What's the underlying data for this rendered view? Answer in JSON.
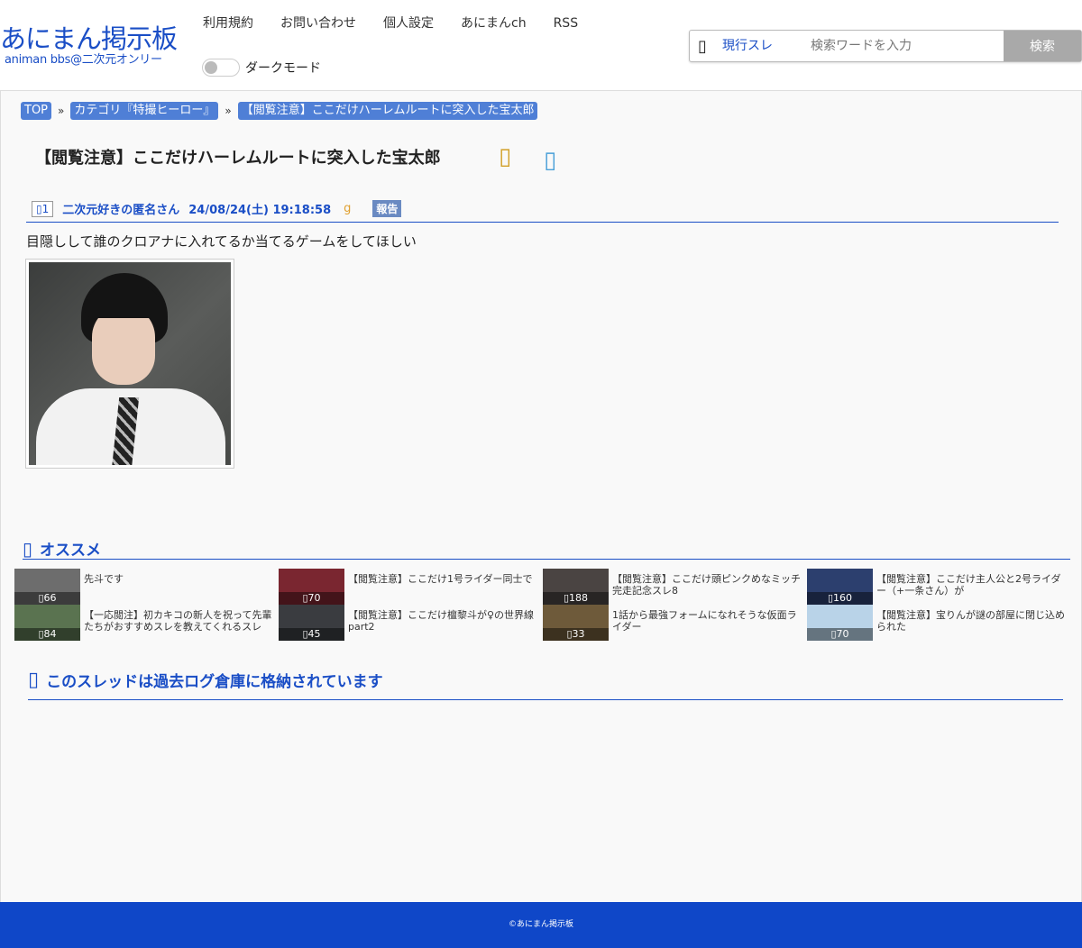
{
  "logo": {
    "main": "あにまん掲示板",
    "sub": "animan bbs@二次元オンリー"
  },
  "nav": [
    "利用規約",
    "お問い合わせ",
    "個人設定",
    "あにまんch",
    "RSS"
  ],
  "dark_mode_label": "ダークモード",
  "search": {
    "scope": "現行スレ",
    "placeholder": "検索ワードを入力",
    "button": "検索"
  },
  "breadcrumb": [
    "TOP",
    "カテゴリ『特撮ヒーロー』",
    "【閲覧注意】ここだけハーレムルートに突入した宝太郎"
  ],
  "breadcrumb_sep": "»",
  "thread": {
    "title": "【閲覧注意】ここだけハーレムルートに突入した宝太郎",
    "post": {
      "number": "1",
      "name": "二次元好きの匿名さん",
      "date": "24/08/24(土) 19:18:58",
      "mark": "g",
      "report": "報告",
      "body": "目隠しして誰のクロアナに入れてるか当てるゲームをしてほしい"
    }
  },
  "recommend": {
    "title": "オススメ",
    "items": [
      {
        "text": "先斗です",
        "count": "66",
        "color": "#6d6d6d"
      },
      {
        "text": "【閲覧注意】ここだけ1号ライダー同士で",
        "count": "70",
        "color": "#7a2630"
      },
      {
        "text": "【閲覧注意】ここだけ頭ピンクめなミッチ完走記念スレ8",
        "count": "188",
        "color": "#4a4442"
      },
      {
        "text": "【閲覧注意】ここだけ主人公と2号ライダー（+一条さん）が",
        "count": "160",
        "color": "#2c3f6e"
      },
      {
        "text": "【一応閲注】初カキコの新人を祝って先輩たちがおすすめスレを教えてくれるスレ",
        "count": "84",
        "color": "#5a7350"
      },
      {
        "text": "【閲覧注意】ここだけ檀黎斗が♀の世界線part2",
        "count": "45",
        "color": "#3a3c40"
      },
      {
        "text": "1話から最強フォームになれそうな仮面ライダー",
        "count": "33",
        "color": "#6e5a3a"
      },
      {
        "text": "【閲覧注意】宝りんが謎の部屋に閉じ込められた",
        "count": "70",
        "color": "#b9d3e8"
      }
    ]
  },
  "archived_title": "このスレッドは過去ログ倉庫に格納されています",
  "footer": "©あにまん掲示板"
}
